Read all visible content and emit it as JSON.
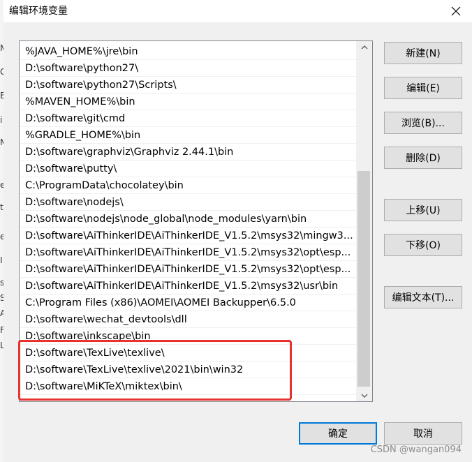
{
  "window": {
    "title": "编辑环境变量"
  },
  "background_window_chars": [
    "M",
    "G",
    "B",
    "i",
    "M",
    "e",
    "t",
    "e",
    "I",
    "s",
    "S",
    "A",
    "F",
    "L"
  ],
  "paths": [
    "%JAVA_HOME%\\jre\\bin",
    "D:\\software\\python27\\",
    "D:\\software\\python27\\Scripts\\",
    "%MAVEN_HOME%\\bin",
    "D:\\software\\git\\cmd",
    "%GRADLE_HOME%\\bin",
    "D:\\software\\graphviz\\Graphviz 2.44.1\\bin",
    "D:\\software\\putty\\",
    "C:\\ProgramData\\chocolatey\\bin",
    "D:\\software\\nodejs\\",
    "D:\\software\\nodejs\\node_global\\node_modules\\yarn\\bin",
    "D:\\software\\AiThinkerIDE\\AiThinkerIDE_V1.5.2\\msys32\\mingw3...",
    "D:\\software\\AiThinkerIDE\\AiThinkerIDE_V1.5.2\\msys32\\opt\\esp...",
    "D:\\software\\AiThinkerIDE\\AiThinkerIDE_V1.5.2\\msys32\\opt\\esp...",
    "D:\\software\\AiThinkerIDE\\AiThinkerIDE_V1.5.2\\msys32\\usr\\bin",
    "C:\\Program Files (x86)\\AOMEI\\AOMEI Backupper\\6.5.0",
    "D:\\software\\wechat_devtools\\dll",
    "D:\\software\\inkscape\\bin",
    "D:\\software\\TexLive\\texlive\\",
    "D:\\software\\TexLive\\texlive\\2021\\bin\\win32",
    "D:\\software\\MiKTeX\\miktex\\bin\\"
  ],
  "buttons": {
    "new": "新建(N)",
    "edit": "编辑(E)",
    "browse": "浏览(B)...",
    "delete": "删除(D)",
    "move_up": "上移(U)",
    "move_down": "下移(O)",
    "edit_text": "编辑文本(T)...",
    "ok": "确定",
    "cancel": "取消"
  },
  "watermark": "CSDN @wangan094",
  "colors": {
    "highlight_box": "#e8322e",
    "default_button_border": "#0078d7"
  }
}
